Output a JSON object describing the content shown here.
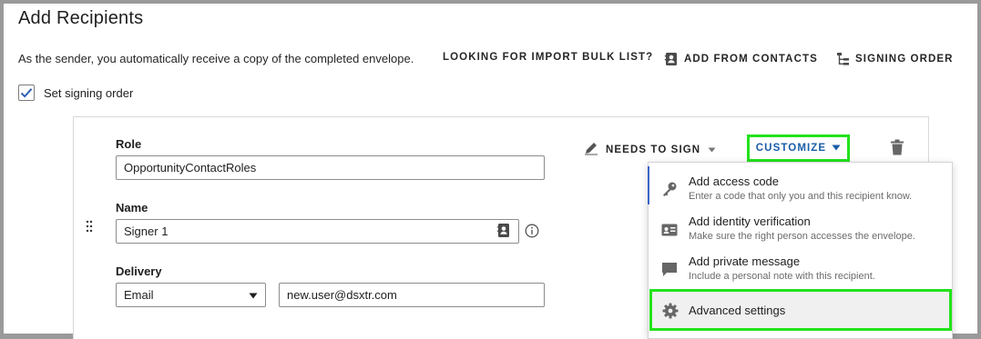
{
  "page": {
    "title": "Add Recipients",
    "hint": "As the sender, you automatically receive a copy of the completed envelope.",
    "links": {
      "import_bulk": "LOOKING FOR IMPORT BULK LIST?",
      "add_contacts": "ADD FROM CONTACTS",
      "signing_order": "SIGNING ORDER"
    },
    "signing_order_checkbox": {
      "label": "Set signing order",
      "checked": true
    }
  },
  "recipient": {
    "role_label": "Role",
    "role_value": "OpportunityContactRoles",
    "name_label": "Name",
    "name_value": "Signer 1",
    "delivery_label": "Delivery",
    "delivery_method": "Email",
    "email_value": "new.user@dsxtr.com",
    "action": "NEEDS TO SIGN",
    "customize": "CUSTOMIZE"
  },
  "customize_menu": {
    "items": [
      {
        "icon": "key-icon",
        "title": "Add access code",
        "description": "Enter a code that only you and this recipient know."
      },
      {
        "icon": "id-card-icon",
        "title": "Add identity verification",
        "description": "Make sure the right person accesses the envelope."
      },
      {
        "icon": "chat-bubble-icon",
        "title": "Add private message",
        "description": "Include a personal note with this recipient."
      },
      {
        "icon": "gear-icon",
        "title": "Advanced settings",
        "description": ""
      }
    ]
  },
  "colors": {
    "accent_blue": "#1a5ca8",
    "highlight_green": "#22e31b",
    "menu_accent": "#3a64c8"
  }
}
